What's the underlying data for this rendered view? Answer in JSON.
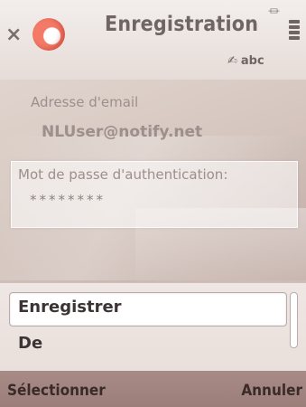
{
  "header": {
    "title": "Enregistration",
    "close_icon": "close-icon",
    "app_icon": "ring-app-icon",
    "signal_icon": "signal-icon",
    "battery_icon": "battery-icon",
    "input_mode": "abc",
    "input_mode_icon": "pen-icon"
  },
  "form": {
    "email_label": "Adresse d'email",
    "email_value": "NLUser@notify.net",
    "password_label": "Mot de passe d'authentication:",
    "password_value": "********"
  },
  "menu": {
    "items": [
      {
        "label": "Enregistrer"
      },
      {
        "label": "De"
      }
    ]
  },
  "softkeys": {
    "left": "Sélectionner",
    "right": "Annuler"
  }
}
